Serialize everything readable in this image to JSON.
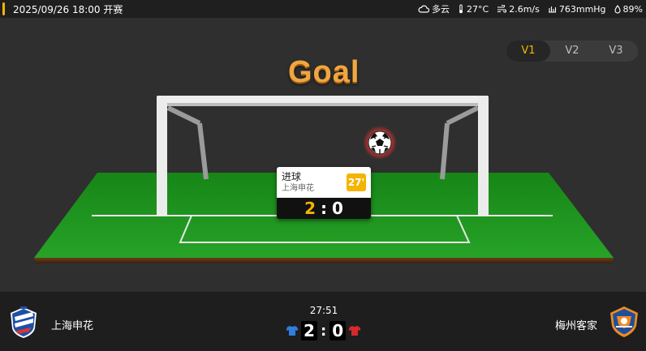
{
  "header": {
    "datetime_status": "2025/09/26 18:00 开赛"
  },
  "weather": {
    "condition": "多云",
    "temperature": "27°C",
    "wind": "2.6m/s",
    "pressure": "763mmHg",
    "humidity": "89%"
  },
  "view_tabs": [
    {
      "label": "V1",
      "active": true
    },
    {
      "label": "V2",
      "active": false
    },
    {
      "label": "V3",
      "active": false
    }
  ],
  "animation": {
    "title": "Goal",
    "event": {
      "label": "进球",
      "team": "上海申花",
      "minute": "27'",
      "home_score": "2",
      "separator": ":",
      "away_score": "0"
    }
  },
  "match": {
    "home_team": "上海申花",
    "away_team": "梅州客家",
    "clock": "27:51",
    "home_score": "2",
    "away_score": "0",
    "home_kit_color": "#2f7ee0",
    "away_kit_color": "#d42a2a"
  },
  "colors": {
    "accent": "#f4b400",
    "pitch": "#1e8a1e"
  }
}
